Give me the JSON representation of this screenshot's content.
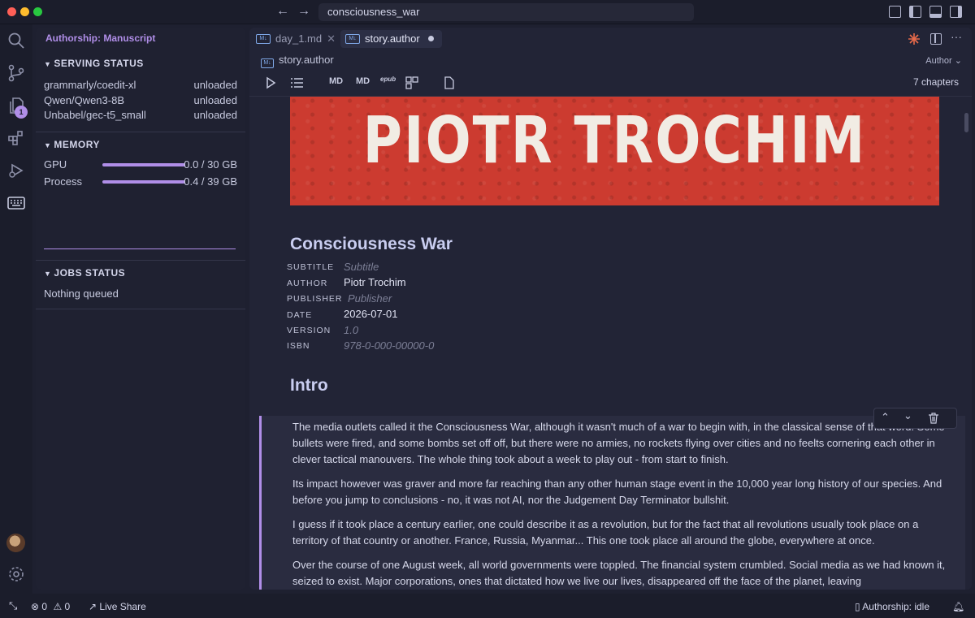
{
  "titlebar": {
    "search_text": "consciousness_war"
  },
  "activitybar": {
    "explorer_badge": "1"
  },
  "sidebar": {
    "title": "Authorship: Manuscript",
    "serving": {
      "heading": "SERVING STATUS",
      "models": [
        {
          "name": "grammarly/coedit-xl",
          "status": "unloaded"
        },
        {
          "name": "Qwen/Qwen3-8B",
          "status": "unloaded"
        },
        {
          "name": "Unbabel/gec-t5_small",
          "status": "unloaded"
        }
      ]
    },
    "memory": {
      "heading": "MEMORY",
      "gpu_label": "GPU",
      "gpu_value": "0.0 / 30 GB",
      "gpu_used_fraction": 0.0,
      "process_label": "Process",
      "process_value": "0.4 / 39 GB",
      "process_used_fraction": 0.01
    },
    "jobs": {
      "heading": "JOBS STATUS",
      "status": "Nothing queued"
    }
  },
  "editor": {
    "tabs": [
      {
        "label": "day_1.md",
        "icon": "markdown-icon"
      },
      {
        "label": "story.author",
        "icon": "markdown-icon"
      }
    ],
    "breadcrumb": "story.author",
    "author_dropdown": "Author",
    "toolbar": {
      "md1": "MD",
      "md2": "MD",
      "epub": "epub",
      "chapters": "7 chapters"
    },
    "banner_text": "PIOTR TROCHIM",
    "doc_title": "Consciousness War",
    "meta": {
      "subtitle_label": "SUBTITLE",
      "subtitle_value": "Subtitle",
      "author_label": "AUTHOR",
      "author_value": "Piotr Trochim",
      "publisher_label": "PUBLISHER",
      "publisher_value": "Publisher",
      "date_label": "DATE",
      "date_value": "2026-07-01",
      "version_label": "VERSION",
      "version_value": "1.0",
      "isbn_label": "ISBN",
      "isbn_value": "978-0-000-00000-0"
    },
    "intro_heading": "Intro",
    "paragraphs": [
      "The media outlets called it the Consciousness War, although it wasn't much of a war to begin with, in the classical sense of that word. Some bullets were fired, and some bombs set off off, but there were no armies, no rockets flying over cities and no feelts cornering each other in clever tactical manouvers. The whole thing took about a week to play out - from start to finish.",
      "Its impact however was graver and more far reaching than any other human stage event in the 10,000 year long history of our species. And before you jump to conclusions - no, it was not AI, nor the Judgement Day Terminator bullshit.",
      "I guess if it took place a century earlier, one could describe it as a revolution, but for the fact that all revolutions usually took place on a territory of that country or another. France, Russia, Myanmar... This one took place all around the globe, everywhere at once.",
      "Over the course of one August week, all world governments were toppled. The financial system crumbled. Social media as we had known it, seized to exist. Major corporations, ones that dictated how we live our lives, disappeared off the face of the planet, leaving"
    ]
  },
  "statusbar": {
    "errors": "0",
    "warnings": "0",
    "live_share": "Live Share",
    "authorship_status": "Authorship: idle"
  },
  "colors": {
    "accent": "#b08ee8",
    "banner": "#cc3b30",
    "background": "#1e2030"
  }
}
